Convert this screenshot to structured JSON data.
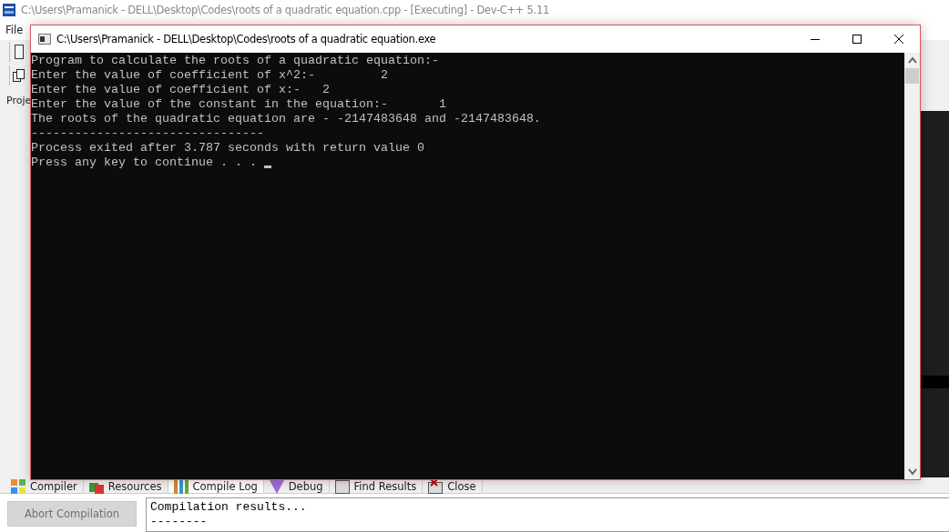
{
  "ide": {
    "title": "C:\\Users\\Pramanick - DELL\\Desktop\\Codes\\roots of a quadratic equation.cpp - [Executing] - Dev-C++ 5.11",
    "menu": [
      "File"
    ],
    "side_tab": "Proje",
    "bottom_tabs": [
      {
        "label": "Compiler",
        "selected": false
      },
      {
        "label": "Resources",
        "selected": false
      },
      {
        "label": "Compile Log",
        "selected": true
      },
      {
        "label": "Debug",
        "selected": false
      },
      {
        "label": "Find Results",
        "selected": false
      },
      {
        "label": "Close",
        "selected": false
      }
    ],
    "abort_button": {
      "label": "Abort Compilation",
      "disabled": true
    },
    "log_lines": [
      "Compilation results...",
      "--------"
    ]
  },
  "console": {
    "title": "C:\\Users\\Pramanick - DELL\\Desktop\\Codes\\roots of a quadratic equation.exe",
    "lines": [
      "Program to calculate the roots of a quadratic equation:-",
      "Enter the value of coefficient of x^2:-         2",
      "Enter the value of coefficient of x:-   2",
      "Enter the value of the constant in the equation:-       1",
      "The roots of the quadratic equation are - -2147483648 and -2147483648.",
      "--------------------------------",
      "Process exited after 3.787 seconds with return value 0",
      "Press any key to continue . . . "
    ],
    "cursor": true
  }
}
